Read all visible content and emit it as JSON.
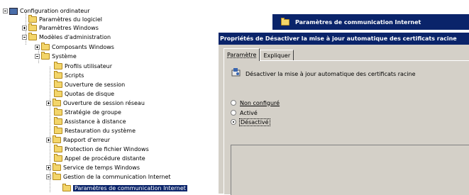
{
  "tree": {
    "root": "Configuration ordinateur",
    "items": [
      "Paramètres du logiciel",
      "Paramètres Windows",
      "Modèles d'administration",
      "Composants Windows",
      "Système",
      "Profils utilisateur",
      "Scripts",
      "Ouverture de session",
      "Quotas de disque",
      "Ouverture de session réseau",
      "Stratégie de groupe",
      "Assistance à distance",
      "Restauration du système",
      "Rapport d'erreur",
      "Protection de fichier Windows",
      "Appel de procédure distante",
      "Service de temps Windows",
      "Gestion de la communication Internet",
      "Paramètres de communication Internet"
    ]
  },
  "background_window": {
    "title": "Paramètres de communication Internet"
  },
  "dialog": {
    "title": "Propriétés de Désactiver la mise à jour automatique des certificats racine",
    "tabs": [
      "Paramètre",
      "Expliquer"
    ],
    "policy_name": "Désactiver la mise à jour automatique des certificats racine",
    "options": [
      "Non configuré",
      "Activé",
      "Désactivé"
    ],
    "selected_option": "Désactivé"
  },
  "colors": {
    "titlebar": "#0a246a",
    "dialog_face": "#d4d0c8",
    "folder": "#f3d56a"
  }
}
